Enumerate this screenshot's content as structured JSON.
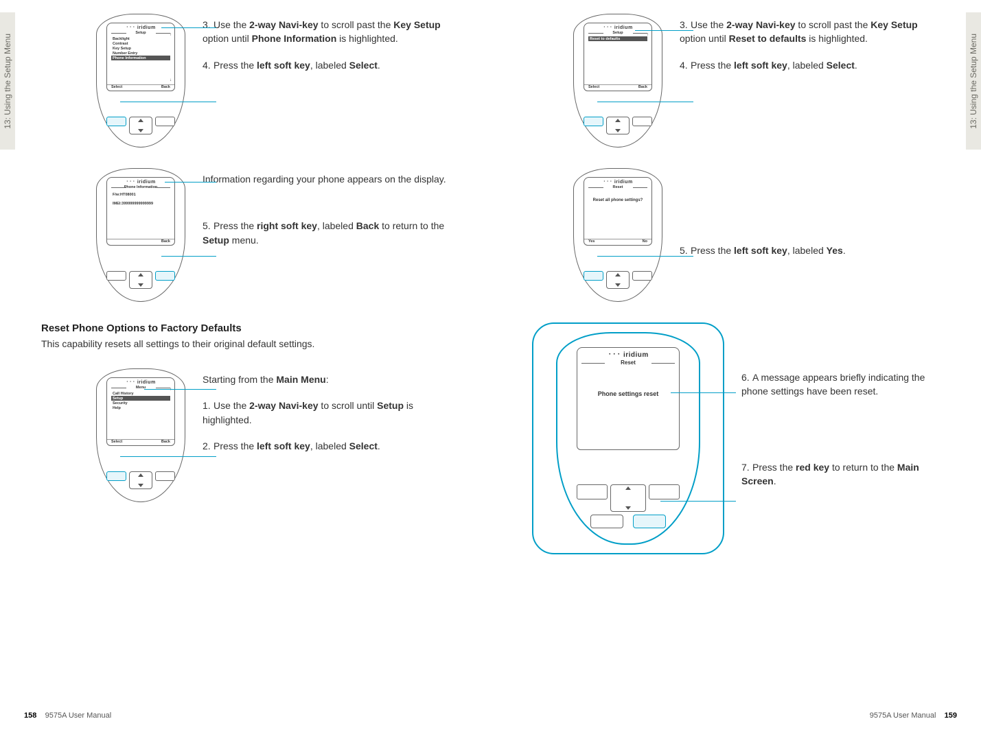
{
  "chapter_tab": "13: Using the Setup Menu",
  "left": {
    "footer_page": "158",
    "footer_doc": "9575A User Manual",
    "phone1": {
      "brand": "᛫᛫᛫ iridium",
      "title": "Setup",
      "items": [
        "Backlight",
        "Contrast",
        "Key Setup",
        "Number Entry",
        "Phone Information"
      ],
      "hl_index": 4,
      "left_soft": "Select",
      "right_soft": "Back"
    },
    "step3": "Use the <b>2-way Navi-key</b> to scroll past the <b>Key Setup</b> option until <b>Phone Information</b> is highlighted.",
    "step4": "Press the <b>left soft key</b>, labeled <b>Select</b>.",
    "phone2": {
      "brand": "᛫᛫᛫ iridium",
      "title": "Phone Information",
      "line1": "F/w:HT08001",
      "line2": "IMEI:399999999999999",
      "right_soft": "Back"
    },
    "info_text": "Information regarding your phone appears on the display.",
    "step5": "Press the <b>right soft key</b>, labeled <b>Back</b> to return to the <b>Setup</b> menu.",
    "section_title": "Reset Phone Options to Factory Defaults",
    "section_sub": "This capability resets all settings to their original default settings.",
    "phone3": {
      "brand": "᛫᛫᛫ iridium",
      "title": "Menu",
      "items": [
        "Call History",
        "Setup",
        "Security",
        "Help"
      ],
      "hl_index": 1,
      "left_soft": "Select",
      "right_soft": "Back"
    },
    "starting": "Starting from the <b>Main Menu</b>:",
    "step1": "Use the <b>2-way Navi-key</b> to scroll until <b>Setup</b> is highlighted.",
    "step2": "Press the <b>left soft key</b>, labeled <b>Select</b>."
  },
  "right": {
    "footer_page": "159",
    "footer_doc": "9575A User Manual",
    "phone4": {
      "brand": "᛫᛫᛫ iridium",
      "title": "Setup",
      "items": [
        "Reset to defaults"
      ],
      "hl_index": 0,
      "left_soft": "Select",
      "right_soft": "Back"
    },
    "step3r": "Use the <b>2-way Navi-key</b> to scroll past the <b>Key Setup</b> option until <b>Reset to defaults</b> is highlighted.",
    "step4r": "Press the <b>left soft key</b>, labeled <b>Select</b>.",
    "phone5": {
      "brand": "᛫᛫᛫ iridium",
      "title": "Reset",
      "body": "Reset all phone settings?",
      "left_soft": "Yes",
      "right_soft": "No"
    },
    "step5r": "Press the <b>left soft key</b>, labeled <b>Yes</b>.",
    "phone6": {
      "brand": "᛫᛫᛫ iridium",
      "title": "Reset",
      "body": "Phone settings reset"
    },
    "step6r": "A message appears briefly indicating the phone settings have been reset.",
    "step7r": "Press the <b>red key</b> to return to the <b>Main Screen</b>."
  }
}
